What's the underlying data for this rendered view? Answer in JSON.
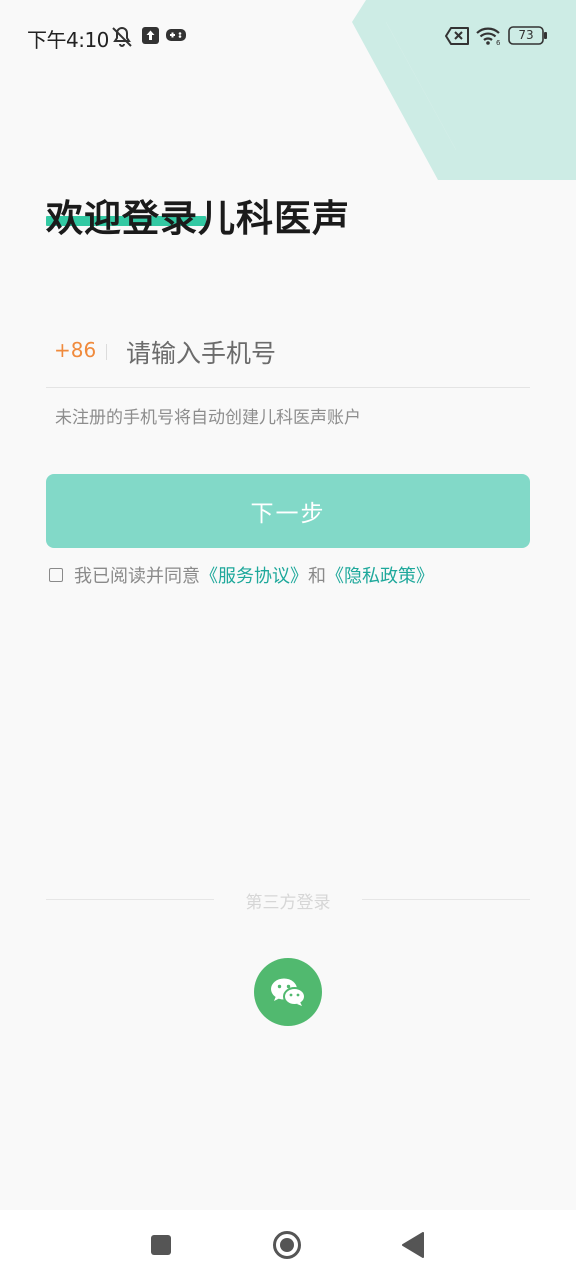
{
  "status_bar": {
    "time": "下午4:10",
    "battery": "73",
    "icons": [
      "mute-icon",
      "upload-icon",
      "game-icon",
      "sim-missing-icon",
      "wifi-icon",
      "battery-icon"
    ]
  },
  "title": "欢迎登录儿科医声",
  "phone": {
    "country_code": "+86",
    "placeholder": "请输入手机号",
    "value": ""
  },
  "hint": "未注册的手机号将自动创建儿科医声账户",
  "next_label": "下一步",
  "agreement": {
    "checked": false,
    "prefix": "我已阅读并同意",
    "service_link": "《服务协议》",
    "and": "和",
    "privacy_link": "《隐私政策》"
  },
  "third_party": {
    "label": "第三方登录",
    "providers": [
      "wechat"
    ]
  },
  "nav": [
    "recents",
    "home",
    "back"
  ],
  "colors": {
    "accent": "#33c9a3",
    "button": "#82d9c8",
    "link": "#1ea89b",
    "country_code": "#f08a3c",
    "wechat": "#51b96f",
    "decoration": "#cdece5"
  }
}
